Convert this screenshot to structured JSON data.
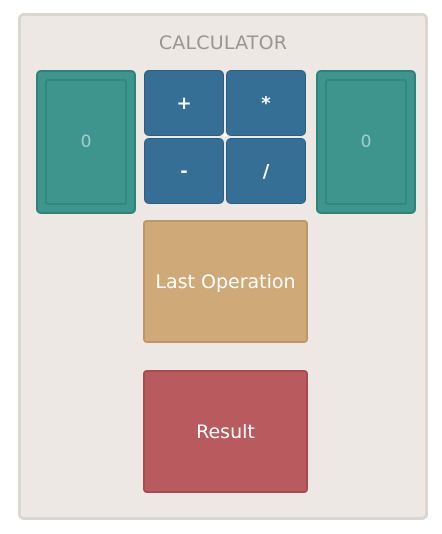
{
  "title": "CALCULATOR",
  "left_operand": "0",
  "right_operand": "0",
  "operators": {
    "add": "+",
    "multiply": "*",
    "subtract": "-",
    "divide": "/"
  },
  "last_operation_label": "Last Operation",
  "result_label": "Result",
  "colors": {
    "card_bg": "#ede8e4",
    "operand": "#3e958d",
    "operator": "#356f96",
    "last_operation": "#cfa977",
    "result": "#b95a5f"
  }
}
